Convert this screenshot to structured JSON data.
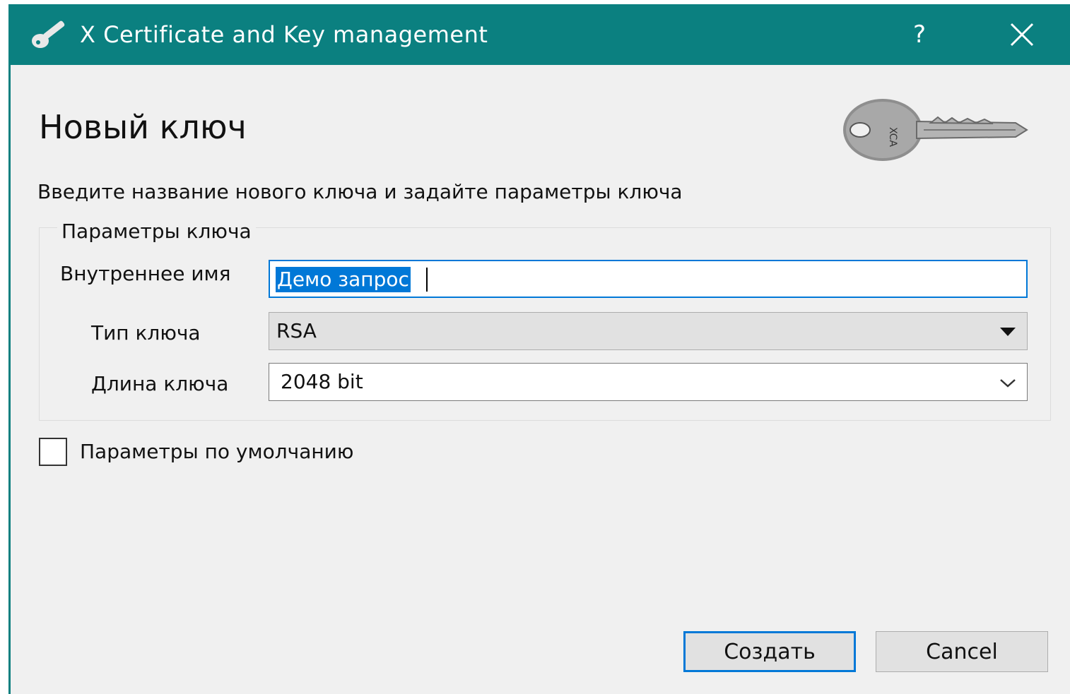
{
  "window": {
    "title": "X Certificate and Key management",
    "help_label": "?",
    "accent_color": "#0b8080"
  },
  "page": {
    "title": "Новый ключ",
    "instruction": "Введите название нового ключа и задайте параметры ключа"
  },
  "key_params": {
    "legend": "Параметры ключа",
    "name_label": "Внутреннее имя",
    "name_value": "Демо запрос",
    "type_label": "Тип ключа",
    "type_value": "RSA",
    "length_label": "Длина ключа",
    "length_value": "2048 bit"
  },
  "defaults_checkbox": {
    "label": "Параметры по умолчанию",
    "checked": false
  },
  "buttons": {
    "create_label": "Создать",
    "cancel_label": "Cancel"
  },
  "key_graphic_text": "XCA",
  "icons": [
    "key-icon",
    "help-icon",
    "close-icon",
    "dropdown-arrow-icon",
    "chevron-down-icon",
    "key-graphic"
  ]
}
